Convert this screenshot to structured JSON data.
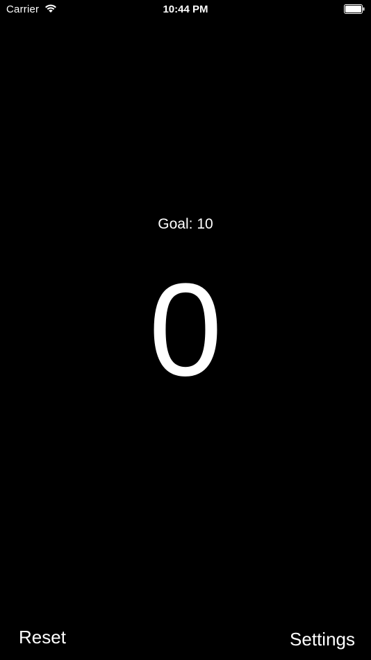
{
  "status_bar": {
    "carrier": "Carrier",
    "time": "10:44 PM",
    "wifi_icon": "wifi-icon",
    "battery_icon": "battery-icon"
  },
  "main": {
    "goal_text": "Goal: 10",
    "counter_value": "0"
  },
  "toolbar": {
    "reset_label": "Reset",
    "settings_label": "Settings"
  },
  "colors": {
    "background": "#000000",
    "text": "#ffffff"
  }
}
